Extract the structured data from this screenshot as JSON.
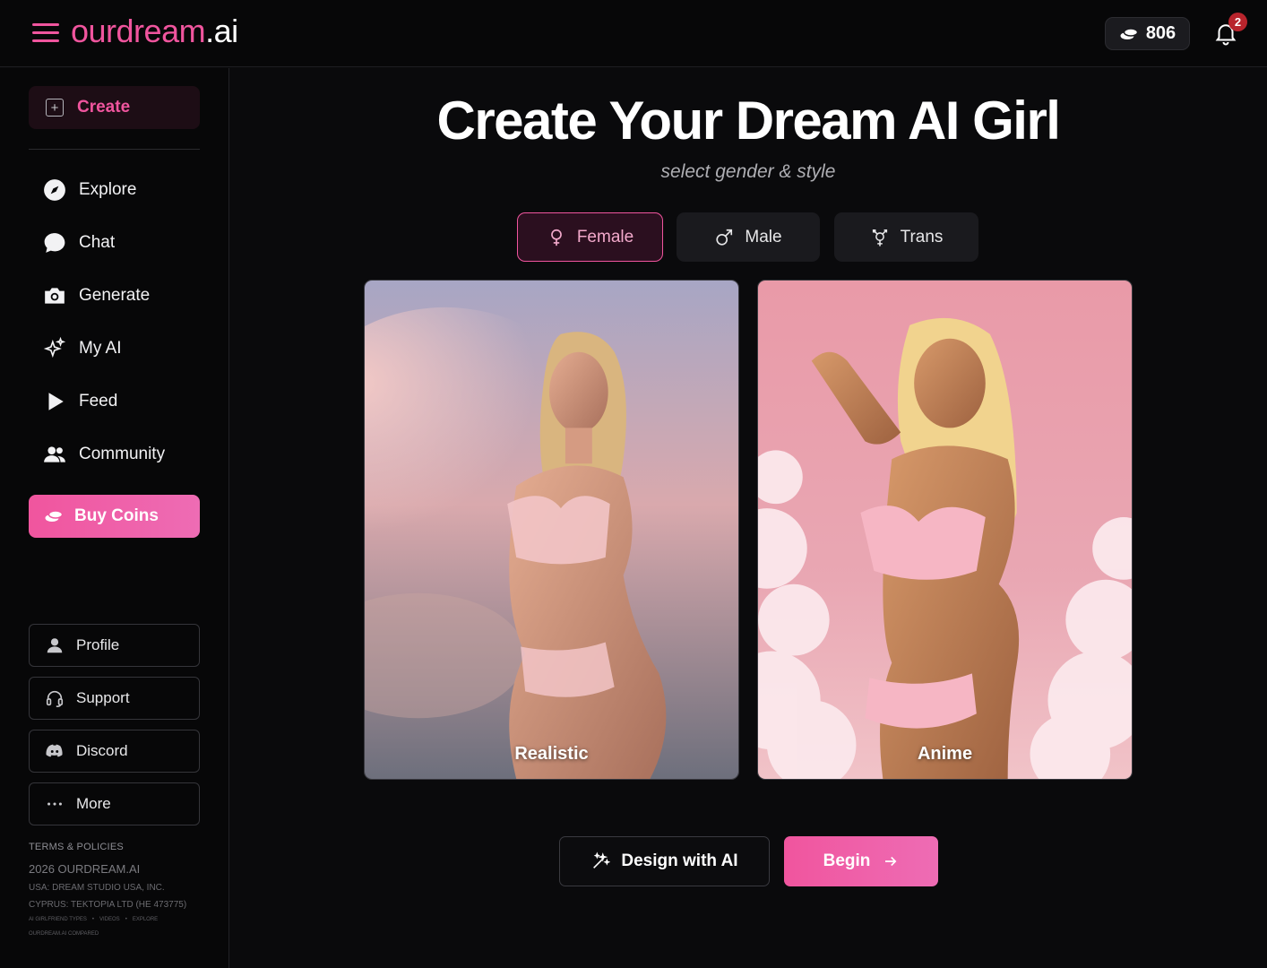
{
  "header": {
    "logo_main": "ourdream",
    "logo_suffix": ".ai",
    "coin_count": "806",
    "notification_count": "2"
  },
  "sidebar": {
    "create_label": "Create",
    "nav": [
      {
        "label": "Explore",
        "icon": "compass-icon"
      },
      {
        "label": "Chat",
        "icon": "chat-bubble-icon"
      },
      {
        "label": "Generate",
        "icon": "camera-icon"
      },
      {
        "label": "My AI",
        "icon": "sparkles-icon"
      },
      {
        "label": "Feed",
        "icon": "play-icon"
      },
      {
        "label": "Community",
        "icon": "users-icon"
      }
    ],
    "buy_coins_label": "Buy Coins",
    "links": [
      {
        "label": "Profile",
        "icon": "user-icon"
      },
      {
        "label": "Support",
        "icon": "headset-icon"
      },
      {
        "label": "Discord",
        "icon": "discord-icon"
      },
      {
        "label": "More",
        "icon": "more-dots-icon"
      }
    ],
    "footer": {
      "terms": "TERMS & POLICIES",
      "copyright": "2026 OURDREAM.AI",
      "usa": "USA: DREAM STUDIO USA, INC.",
      "cyprus": "CYPRUS: TEKTOPIA LTD (HE 473775)",
      "link1": "AI GIRLFRIEND TYPES",
      "link2": "VIDEOS",
      "link3": "EXPLORE",
      "link4": "OURDREAM.AI COMPARED",
      "sep": "•"
    }
  },
  "main": {
    "title": "Create Your Dream AI Girl",
    "subtitle": "select gender & style",
    "genders": [
      {
        "label": "Female",
        "icon": "female-symbol-icon",
        "selected": true
      },
      {
        "label": "Male",
        "icon": "male-symbol-icon",
        "selected": false
      },
      {
        "label": "Trans",
        "icon": "transgender-symbol-icon",
        "selected": false
      }
    ],
    "styles": [
      {
        "label": "Realistic"
      },
      {
        "label": "Anime"
      }
    ],
    "design_label": "Design with AI",
    "begin_label": "Begin"
  },
  "colors": {
    "accent": "#f0559e",
    "background": "#0a0a0c",
    "sidebar": "#070708"
  }
}
